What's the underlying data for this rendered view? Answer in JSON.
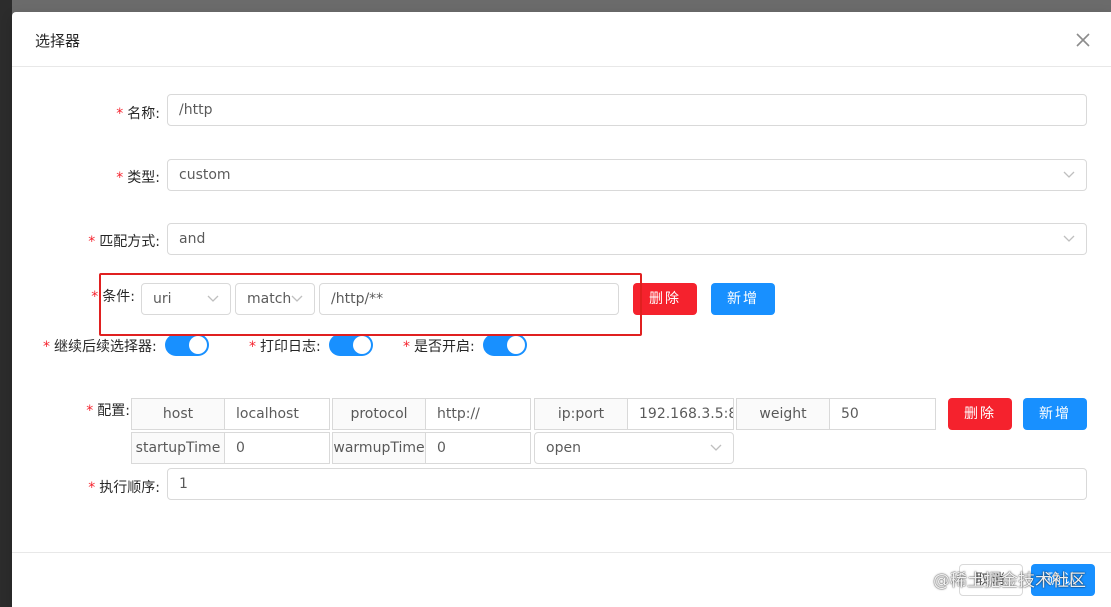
{
  "modal": {
    "title": "选择器"
  },
  "form": {
    "name": {
      "label": "名称:",
      "value": "/http"
    },
    "type": {
      "label": "类型:",
      "value": "custom"
    },
    "match_mode": {
      "label": "匹配方式:",
      "value": "and"
    },
    "condition": {
      "label": "条件:",
      "param_type": "uri",
      "operator": "match",
      "value": "/http/**",
      "delete_label": "删除",
      "add_label": "新增"
    },
    "switches": {
      "continue": {
        "label": "继续后续选择器:",
        "on": true
      },
      "log": {
        "label": "打印日志:",
        "on": true
      },
      "enabled": {
        "label": "是否开启:",
        "on": true
      }
    },
    "config": {
      "label": "配置:",
      "host": {
        "label": "host",
        "value": "localhost"
      },
      "protocol": {
        "label": "protocol",
        "value": "http://"
      },
      "ipport": {
        "label": "ip:port",
        "value": "192.168.3.5:8"
      },
      "weight": {
        "label": "weight",
        "value": "50"
      },
      "startup": {
        "label": "startupTime",
        "value": "0"
      },
      "warmup": {
        "label": "warmupTime",
        "value": "0"
      },
      "status": "open",
      "delete_label": "删除",
      "add_label": "新增"
    },
    "sort": {
      "label": "执行顺序:",
      "value": "1"
    }
  },
  "footer": {
    "cancel_label": "取消",
    "ok_label": "确认"
  },
  "watermark": "@稀土掘金技术社区",
  "colors": {
    "primary": "#1890ff",
    "danger": "#f5222d",
    "highlight": "#e02020"
  }
}
